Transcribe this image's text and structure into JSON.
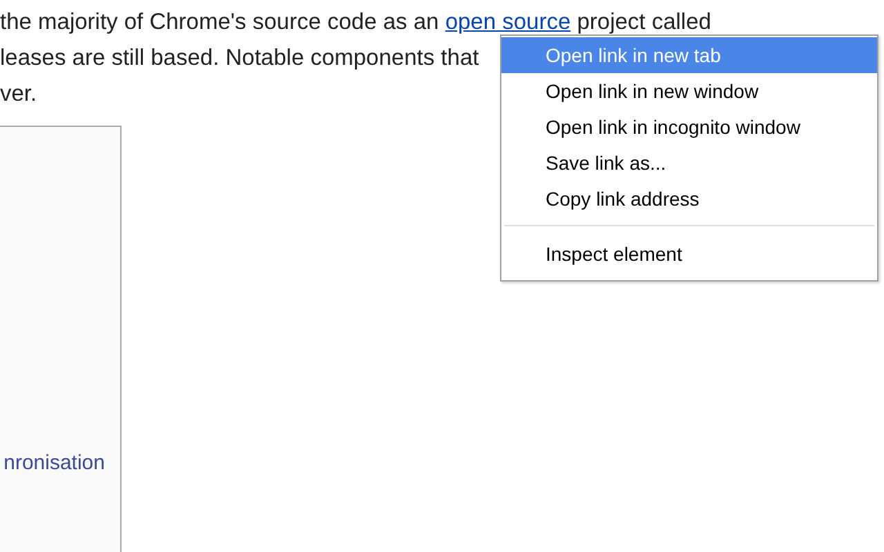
{
  "article": {
    "lines": [
      {
        "before": "the majority of Chrome's source code as an ",
        "link": "open source",
        "after": " project called"
      },
      {
        "text": "leases are still based. Notable components that"
      },
      {
        "text": "ver."
      }
    ]
  },
  "infobox": {
    "link": "nronisation"
  },
  "context_menu": {
    "groups": [
      [
        {
          "label": "Open link in new tab",
          "selected": true
        },
        {
          "label": "Open link in new window",
          "selected": false
        },
        {
          "label": "Open link in incognito window",
          "selected": false
        },
        {
          "label": "Save link as...",
          "selected": false
        },
        {
          "label": "Copy link address",
          "selected": false
        }
      ],
      [
        {
          "label": "Inspect element",
          "selected": false
        }
      ]
    ]
  }
}
